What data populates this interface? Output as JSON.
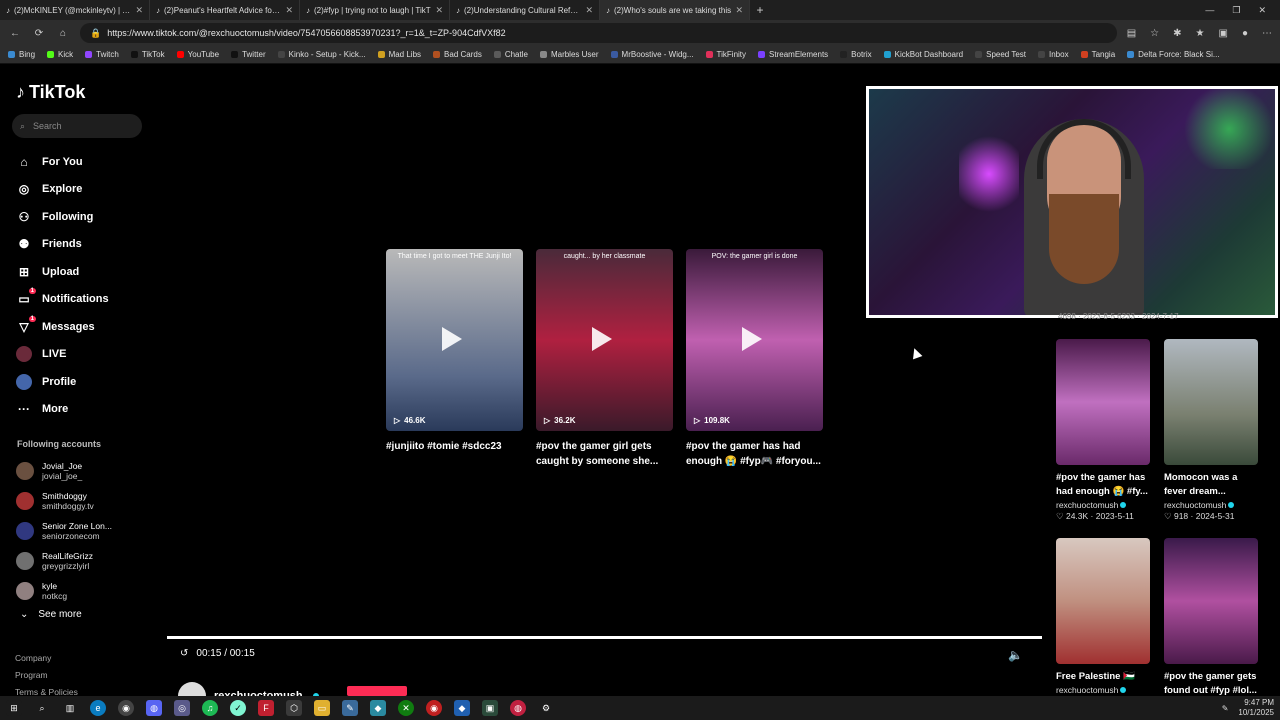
{
  "browser": {
    "tabs": [
      {
        "label": "(2)McKINLEY (@mckinleytv) | TikT"
      },
      {
        "label": "(2)Peanut's Heartfelt Advice for G"
      },
      {
        "label": "(2)#fyp | trying not to laugh | TikT"
      },
      {
        "label": "(2)Understanding Cultural Refere"
      },
      {
        "label": "(2)Who's souls are we taking this"
      }
    ],
    "url": "https://www.tiktok.com/@rexchuoctomush/video/7547056608853970231?_r=1&_t=ZP-904CdfVXf82",
    "bookmarks": [
      "Bing",
      "Kick",
      "Twitch",
      "TikTok",
      "YouTube",
      "Twitter",
      "Kinko - Setup - Kick...",
      "Mad Libs",
      "Bad Cards",
      "Chatle",
      "Marbles User",
      "MrBoostive - Widg...",
      "TikFinity",
      "StreamElements",
      "Botrix",
      "KickBot Dashboard",
      "Speed Test",
      "Inbox",
      "Tangia",
      "Delta Force: Black Si..."
    ]
  },
  "sidebar": {
    "logo": "TikTok",
    "search_placeholder": "Search",
    "nav": [
      {
        "label": "For You",
        "icon": "home-icon"
      },
      {
        "label": "Explore",
        "icon": "compass-icon"
      },
      {
        "label": "Following",
        "icon": "user-follow-icon"
      },
      {
        "label": "Friends",
        "icon": "friends-icon"
      },
      {
        "label": "Upload",
        "icon": "upload-icon"
      },
      {
        "label": "Notifications",
        "icon": "bell-icon",
        "badge": "1"
      },
      {
        "label": "Messages",
        "icon": "send-icon",
        "badge": "1"
      },
      {
        "label": "LIVE",
        "icon": "live-icon"
      },
      {
        "label": "Profile",
        "icon": "profile-icon"
      },
      {
        "label": "More",
        "icon": "more-icon"
      }
    ],
    "following_title": "Following accounts",
    "accounts": [
      {
        "name": "Jovial_Joe",
        "handle": "jovial_joe_"
      },
      {
        "name": "Smithdoggy",
        "handle": "smithdoggy.tv"
      },
      {
        "name": "Senior Zone Lon...",
        "handle": "seniorzonecom"
      },
      {
        "name": "RealLifeGrizz",
        "handle": "greygrizzlyirl"
      },
      {
        "name": "kyle",
        "handle": "notkcg"
      }
    ],
    "see_more": "See more",
    "footer": [
      "Company",
      "Program",
      "Terms & Policies"
    ]
  },
  "videos": [
    {
      "views": "46.6K",
      "title": "#junjiito #tomie #sdcc23",
      "caption": "That time I got to meet THE Junji Ito!",
      "color": "#8a8a8a"
    },
    {
      "views": "36.2K",
      "title": "#pov the gamer girl gets caught by someone she...",
      "caption": "caught... by her classmate",
      "color": "#7a2440"
    },
    {
      "views": "109.8K",
      "title": "#pov the gamer has had enough 😭 #fyp🎮 #foryou...",
      "caption": "POV: the gamer girl is done",
      "color": "#b04a9a"
    }
  ],
  "right_column": {
    "partial_meta": "4698 · 2023-8-5    6233 · 2024-7-17",
    "cards": [
      {
        "title": "#pov the gamer has had enough 😭 #fy...",
        "author": "rexchuoctomush",
        "meta": "♡ 24.3K · 2023-5-11",
        "color": "#a8489a"
      },
      {
        "title": "Momocon was a fever dream...",
        "author": "rexchuoctomush",
        "meta": "♡ 918 · 2024-5-31",
        "color": "#6f7a70"
      },
      {
        "title": "Free Palestine 🇵🇸",
        "author": "rexchuoctomush",
        "meta": "",
        "color": "#c28a70"
      },
      {
        "title": "#pov the gamer gets found out #fyp #lol...",
        "author": "",
        "meta": "",
        "color": "#6a2a6a"
      }
    ]
  },
  "player": {
    "time": "00:15 / 00:15",
    "author": "rexchuoctomush"
  },
  "taskbar": {
    "time": "9:47 PM",
    "date": "10/1/2025"
  }
}
